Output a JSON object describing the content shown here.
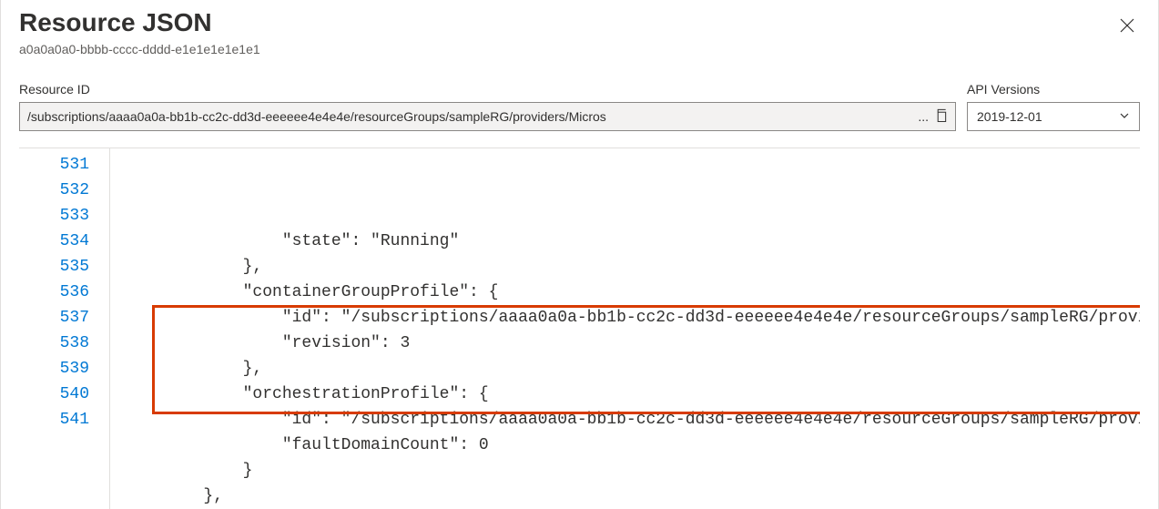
{
  "header": {
    "title": "Resource JSON",
    "subtitle": "a0a0a0a0-bbbb-cccc-dddd-e1e1e1e1e1e1"
  },
  "fields": {
    "resourceId": {
      "label": "Resource ID",
      "value": "/subscriptions/aaaa0a0a-bb1b-cc2c-dd3d-eeeeee4e4e4e/resourceGroups/sampleRG/providers/Micros",
      "ellipsis": "..."
    },
    "apiVersion": {
      "label": "API Versions",
      "value": "2019-12-01"
    }
  },
  "code": {
    "startLine": 531,
    "lines": [
      "                \"state\": \"Running\"",
      "            },",
      "            \"containerGroupProfile\": {",
      "                \"id\": \"/subscriptions/aaaa0a0a-bb1b-cc2c-dd3d-eeeeee4e4e4e/resourceGroups/sampleRG/provi",
      "                \"revision\": 3",
      "            },",
      "            \"orchestrationProfile\": {",
      "                \"id\": \"/subscriptions/aaaa0a0a-bb1b-cc2c-dd3d-eeeeee4e4e4e/resourceGroups/sampleRG/provi",
      "                \"faultDomainCount\": 0",
      "            }",
      "        },"
    ]
  }
}
